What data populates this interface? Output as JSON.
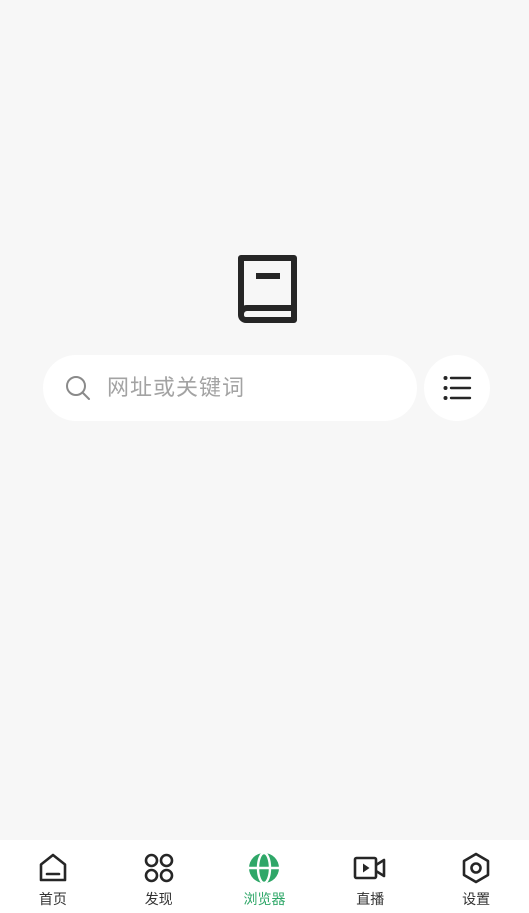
{
  "search": {
    "placeholder": "网址或关键词"
  },
  "colors": {
    "background": "#f7f7f7",
    "icon_dark": "#262626",
    "accent_green": "#2fa768",
    "placeholder_gray": "#a3a3a3"
  },
  "tabs": [
    {
      "label": "首页",
      "icon": "home-icon",
      "active": false
    },
    {
      "label": "发现",
      "icon": "discover-icon",
      "active": false
    },
    {
      "label": "浏览器",
      "icon": "globe-icon",
      "active": true
    },
    {
      "label": "直播",
      "icon": "video-icon",
      "active": false
    },
    {
      "label": "设置",
      "icon": "settings-icon",
      "active": false
    }
  ]
}
